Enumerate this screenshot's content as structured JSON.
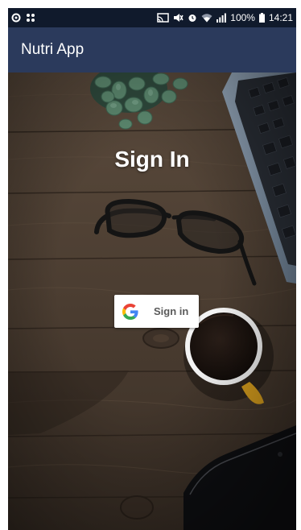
{
  "status_bar": {
    "battery": "100%",
    "time": "14:21"
  },
  "app_bar": {
    "title": "Nutri App"
  },
  "main": {
    "heading": "Sign In",
    "google_button": {
      "label": "Sign in",
      "icon": "google-g-icon"
    }
  },
  "colors": {
    "status_bar_bg": "#101a2c",
    "app_bar_bg": "#2b3a5c",
    "button_bg": "#ffffff",
    "google_blue": "#4285F4",
    "google_red": "#EA4335",
    "google_yellow": "#FBBC05",
    "google_green": "#34A853"
  }
}
